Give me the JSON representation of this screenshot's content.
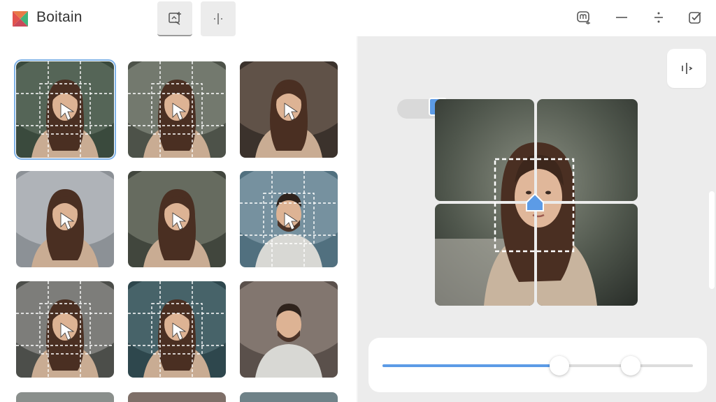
{
  "app": {
    "title": "Boitain",
    "accent_color": "#5c9be6",
    "logo_colors": [
      "#e2524d",
      "#3fb57a"
    ]
  },
  "toolbar": {
    "tools": [
      {
        "name": "add-effect-tool",
        "icon": "frame-plus-icon",
        "active": true
      },
      {
        "name": "split-tool",
        "icon": "split-icon",
        "active": false
      }
    ],
    "window_controls": [
      {
        "name": "mastodon-button",
        "icon": "mastodon-icon"
      },
      {
        "name": "minimize-button",
        "icon": "minus-icon"
      },
      {
        "name": "divide-button",
        "icon": "divide-icon"
      },
      {
        "name": "confirm-button",
        "icon": "checkbox-icon"
      }
    ]
  },
  "gallery": {
    "items": [
      {
        "subject": "woman",
        "overlay": "grid",
        "selected": true
      },
      {
        "subject": "woman",
        "overlay": "grid",
        "selected": false
      },
      {
        "subject": "woman",
        "overlay": "cursor",
        "selected": false
      },
      {
        "subject": "woman",
        "overlay": "cursor",
        "selected": false
      },
      {
        "subject": "woman",
        "overlay": "cursor",
        "selected": false
      },
      {
        "subject": "man",
        "overlay": "grid",
        "selected": false
      },
      {
        "subject": "woman",
        "overlay": "grid",
        "selected": false
      },
      {
        "subject": "woman",
        "overlay": "grid",
        "selected": false
      },
      {
        "subject": "man",
        "overlay": "none",
        "selected": false
      }
    ]
  },
  "preview": {
    "side_button_icon": "split-icon",
    "scale_handle_icon": "square-handle-icon",
    "upload_marker_icon": "upload-marker-icon"
  },
  "slider": {
    "min": 0,
    "max": 100,
    "value_low": 57,
    "value_high": 80
  }
}
